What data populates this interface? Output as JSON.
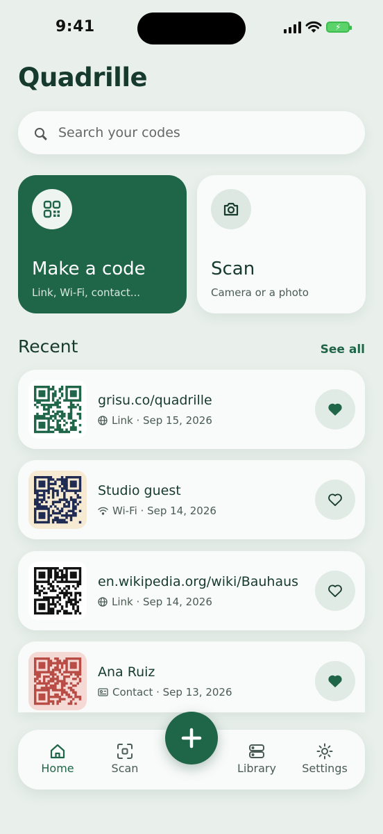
{
  "status_bar": {
    "time": "9:41"
  },
  "app": {
    "title": "Quadrille"
  },
  "search": {
    "placeholder": "Search your codes"
  },
  "actions": {
    "make": {
      "title": "Make a code",
      "subtitle": "Link, Wi-Fi, contact..."
    },
    "scan": {
      "title": "Scan",
      "subtitle": "Camera or a photo"
    }
  },
  "recent": {
    "heading": "Recent",
    "see_all": "See all",
    "items": [
      {
        "title": "grisu.co/quadrille",
        "meta": "Link · Sep 15, 2026",
        "type_icon": "globe-icon",
        "favorite": true,
        "qr_color": "#1f6548",
        "qr_bg": "#ffffff"
      },
      {
        "title": "Studio guest",
        "meta": "Wi-Fi · Sep 14, 2026",
        "type_icon": "wifi-icon",
        "favorite": false,
        "qr_color": "#1e2a52",
        "qr_bg": "#f6ead2"
      },
      {
        "title": "en.wikipedia.org/wiki/Bauhaus",
        "meta": "Link · Sep 14, 2026",
        "type_icon": "globe-icon",
        "favorite": false,
        "qr_color": "#111111",
        "qr_bg": "#ffffff"
      },
      {
        "title": "Ana Ruiz",
        "meta": "Contact · Sep 13, 2026",
        "type_icon": "contact-card-icon",
        "favorite": true,
        "qr_color": "#b84c44",
        "qr_bg": "#f4d9d4"
      }
    ]
  },
  "tabbar": {
    "tabs": [
      {
        "label": "Home",
        "icon": "home-icon",
        "active": true
      },
      {
        "label": "Scan",
        "icon": "scan-icon",
        "active": false
      },
      {
        "label": "Library",
        "icon": "library-icon",
        "active": false
      },
      {
        "label": "Settings",
        "icon": "settings-icon",
        "active": false
      }
    ],
    "fab_icon": "plus-icon"
  },
  "colors": {
    "accent": "#1f6548",
    "background": "#e9f0ec",
    "card": "#f9fbfa"
  }
}
